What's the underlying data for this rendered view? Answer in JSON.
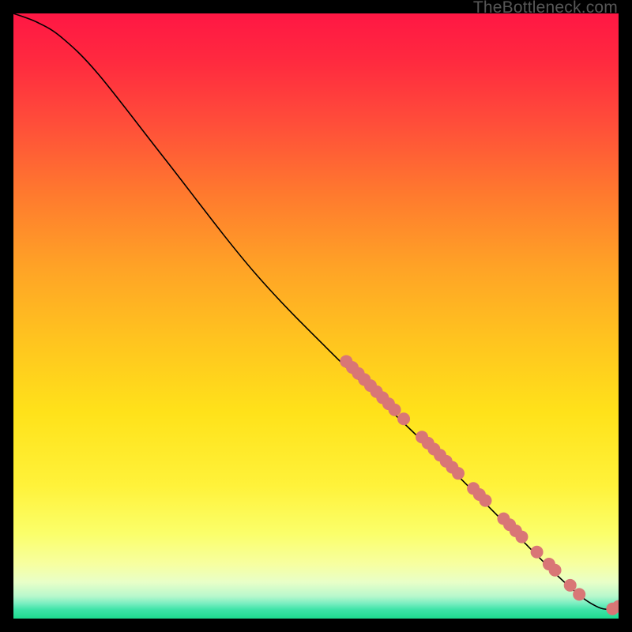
{
  "watermark": "TheBottleneck.com",
  "chart_data": {
    "type": "line",
    "title": "",
    "xlabel": "",
    "ylabel": "",
    "xlim": [
      0,
      100
    ],
    "ylim": [
      0,
      100
    ],
    "grid": false,
    "curve": [
      {
        "x": 0,
        "y": 100
      },
      {
        "x": 4,
        "y": 98.5
      },
      {
        "x": 8,
        "y": 96
      },
      {
        "x": 14,
        "y": 90
      },
      {
        "x": 25,
        "y": 76
      },
      {
        "x": 40,
        "y": 57
      },
      {
        "x": 55,
        "y": 41.5
      },
      {
        "x": 70,
        "y": 27
      },
      {
        "x": 82,
        "y": 15
      },
      {
        "x": 90,
        "y": 7
      },
      {
        "x": 94,
        "y": 3.5
      },
      {
        "x": 96,
        "y": 2.2
      },
      {
        "x": 97.5,
        "y": 1.6
      },
      {
        "x": 99,
        "y": 1.6
      },
      {
        "x": 100,
        "y": 2.0
      }
    ],
    "points": [
      {
        "x": 55.0,
        "y": 42.5
      },
      {
        "x": 56.0,
        "y": 41.5
      },
      {
        "x": 57.0,
        "y": 40.5
      },
      {
        "x": 58.0,
        "y": 39.5
      },
      {
        "x": 59.0,
        "y": 38.5
      },
      {
        "x": 60.0,
        "y": 37.5
      },
      {
        "x": 61.0,
        "y": 36.5
      },
      {
        "x": 62.0,
        "y": 35.5
      },
      {
        "x": 63.0,
        "y": 34.5
      },
      {
        "x": 64.5,
        "y": 33.0
      },
      {
        "x": 67.5,
        "y": 30.0
      },
      {
        "x": 68.5,
        "y": 29.0
      },
      {
        "x": 69.5,
        "y": 28.0
      },
      {
        "x": 70.5,
        "y": 27.0
      },
      {
        "x": 71.5,
        "y": 26.0
      },
      {
        "x": 72.5,
        "y": 25.0
      },
      {
        "x": 73.5,
        "y": 24.0
      },
      {
        "x": 76.0,
        "y": 21.5
      },
      {
        "x": 77.0,
        "y": 20.5
      },
      {
        "x": 78.0,
        "y": 19.5
      },
      {
        "x": 81.0,
        "y": 16.5
      },
      {
        "x": 82.0,
        "y": 15.5
      },
      {
        "x": 83.0,
        "y": 14.5
      },
      {
        "x": 84.0,
        "y": 13.5
      },
      {
        "x": 86.5,
        "y": 11.0
      },
      {
        "x": 88.5,
        "y": 9.0
      },
      {
        "x": 89.5,
        "y": 8.0
      },
      {
        "x": 92.0,
        "y": 5.5
      },
      {
        "x": 93.5,
        "y": 4.0
      },
      {
        "x": 99.0,
        "y": 1.6
      },
      {
        "x": 100.0,
        "y": 2.0
      }
    ],
    "gradient_stops": [
      {
        "offset": 0.0,
        "color": "#ff1744"
      },
      {
        "offset": 0.08,
        "color": "#ff2a3f"
      },
      {
        "offset": 0.18,
        "color": "#ff4d3a"
      },
      {
        "offset": 0.3,
        "color": "#ff7a2e"
      },
      {
        "offset": 0.42,
        "color": "#ffa326"
      },
      {
        "offset": 0.54,
        "color": "#ffc41f"
      },
      {
        "offset": 0.66,
        "color": "#ffe21a"
      },
      {
        "offset": 0.78,
        "color": "#fff23a"
      },
      {
        "offset": 0.86,
        "color": "#fbff6a"
      },
      {
        "offset": 0.91,
        "color": "#f7ffa0"
      },
      {
        "offset": 0.94,
        "color": "#e8ffc8"
      },
      {
        "offset": 0.963,
        "color": "#b8f8cc"
      },
      {
        "offset": 0.975,
        "color": "#7aeec1"
      },
      {
        "offset": 0.985,
        "color": "#3fe4a8"
      },
      {
        "offset": 1.0,
        "color": "#1edb8f"
      }
    ],
    "point_color": "#d97676",
    "curve_color": "#000000",
    "curve_width": 1.6,
    "point_radius": 8
  }
}
